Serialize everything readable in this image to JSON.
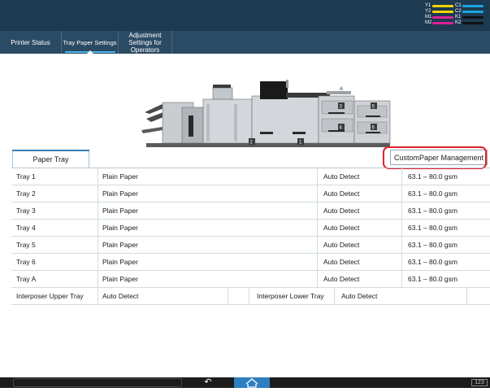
{
  "toner": {
    "rows": [
      [
        {
          "label": "Y1",
          "color": "#f2d400"
        },
        {
          "label": "C1",
          "color": "#19a6e0"
        }
      ],
      [
        {
          "label": "Y2",
          "color": "#f2d400"
        },
        {
          "label": "C2",
          "color": "#19a6e0"
        }
      ],
      [
        {
          "label": "M1",
          "color": "#e0209a"
        },
        {
          "label": "K1",
          "color": "#111111"
        }
      ],
      [
        {
          "label": "M2",
          "color": "#e0209a"
        },
        {
          "label": "K2",
          "color": "#111111"
        }
      ]
    ]
  },
  "tabs": [
    {
      "label": "Printer Status",
      "active": false
    },
    {
      "label": "Tray Paper Settings",
      "active": true
    },
    {
      "label": "Adjustment Settings for Operators",
      "active": false
    }
  ],
  "machine": {
    "tray_labels": [
      "A",
      "3",
      "5",
      "4",
      "6",
      "2",
      "1"
    ]
  },
  "paper_tray_tab": "Paper Tray",
  "custom_paper_button": "CustomPaper Management",
  "trays": [
    {
      "name": "Tray 1",
      "paper": "Plain Paper",
      "size": "Auto Detect",
      "weight": "63.1 – 80.0 gsm"
    },
    {
      "name": "Tray 2",
      "paper": "Plain Paper",
      "size": "Auto Detect",
      "weight": "63.1 – 80.0 gsm"
    },
    {
      "name": "Tray 3",
      "paper": "Plain Paper",
      "size": "Auto Detect",
      "weight": "63.1 – 80.0 gsm"
    },
    {
      "name": "Tray 4",
      "paper": "Plain Paper",
      "size": "Auto Detect",
      "weight": "63.1 – 80.0 gsm"
    },
    {
      "name": "Tray 5",
      "paper": "Plain Paper",
      "size": "Auto Detect",
      "weight": "63.1 – 80.0 gsm"
    },
    {
      "name": "Tray 6",
      "paper": "Plain Paper",
      "size": "Auto Detect",
      "weight": "63.1 – 80.0 gsm"
    },
    {
      "name": "Tray A",
      "paper": "Plain Paper",
      "size": "Auto Detect",
      "weight": "63.1 – 80.0 gsm"
    }
  ],
  "interposer": {
    "upper_label": "Interposer Upper Tray",
    "upper_value": "Auto Detect",
    "lower_label": "Interposer Lower Tray",
    "lower_value": "Auto Detect"
  },
  "bottom": {
    "keyboard_label": "123"
  }
}
